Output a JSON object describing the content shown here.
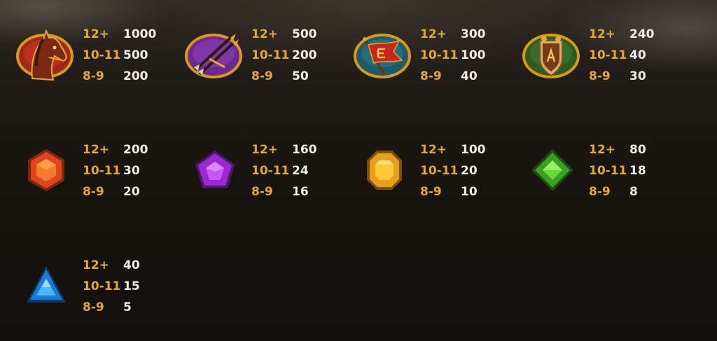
{
  "paytable": {
    "symbols": [
      {
        "name": "horse",
        "icon": "horse-icon",
        "pays": [
          {
            "count": "12+",
            "value": "1000"
          },
          {
            "count": "10-11",
            "value": "500"
          },
          {
            "count": "8-9",
            "value": "200"
          }
        ]
      },
      {
        "name": "arrows",
        "icon": "crossed-arrows-icon",
        "pays": [
          {
            "count": "12+",
            "value": "500"
          },
          {
            "count": "10-11",
            "value": "200"
          },
          {
            "count": "8-9",
            "value": "50"
          }
        ]
      },
      {
        "name": "banner",
        "icon": "war-banner-icon",
        "pays": [
          {
            "count": "12+",
            "value": "300"
          },
          {
            "count": "10-11",
            "value": "100"
          },
          {
            "count": "8-9",
            "value": "40"
          }
        ]
      },
      {
        "name": "shield",
        "icon": "crest-shield-icon",
        "pays": [
          {
            "count": "12+",
            "value": "240"
          },
          {
            "count": "10-11",
            "value": "40"
          },
          {
            "count": "8-9",
            "value": "30"
          }
        ]
      },
      {
        "name": "red-gem",
        "icon": "red-hexagon-gem-icon",
        "pays": [
          {
            "count": "12+",
            "value": "200"
          },
          {
            "count": "10-11",
            "value": "30"
          },
          {
            "count": "8-9",
            "value": "20"
          }
        ]
      },
      {
        "name": "purple-gem",
        "icon": "purple-pentagon-gem-icon",
        "pays": [
          {
            "count": "12+",
            "value": "160"
          },
          {
            "count": "10-11",
            "value": "24"
          },
          {
            "count": "8-9",
            "value": "16"
          }
        ]
      },
      {
        "name": "yellow-gem",
        "icon": "yellow-octagon-gem-icon",
        "pays": [
          {
            "count": "12+",
            "value": "100"
          },
          {
            "count": "10-11",
            "value": "20"
          },
          {
            "count": "8-9",
            "value": "10"
          }
        ]
      },
      {
        "name": "green-gem",
        "icon": "green-diamond-gem-icon",
        "pays": [
          {
            "count": "12+",
            "value": "80"
          },
          {
            "count": "10-11",
            "value": "18"
          },
          {
            "count": "8-9",
            "value": "8"
          }
        ]
      },
      {
        "name": "blue-gem",
        "icon": "blue-triangle-gem-icon",
        "pays": [
          {
            "count": "12+",
            "value": "40"
          },
          {
            "count": "10-11",
            "value": "15"
          },
          {
            "count": "8-9",
            "value": "5"
          }
        ]
      }
    ]
  },
  "colors": {
    "count_text": "#e3a637",
    "value_text": "#f1ece4",
    "background": "#14110e"
  }
}
